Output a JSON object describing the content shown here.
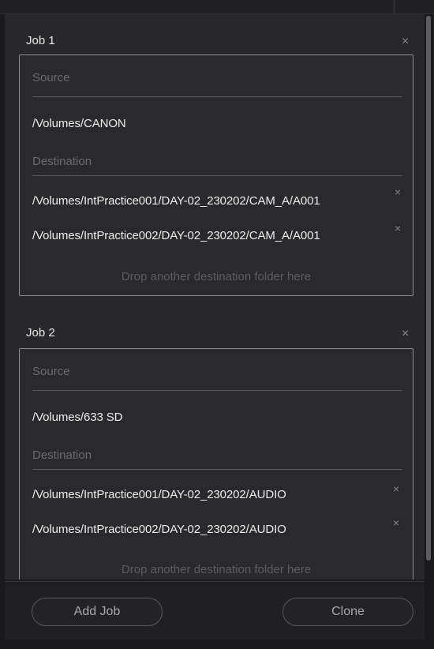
{
  "jobs": [
    {
      "title": "Job 1",
      "close_icon": "close-icon",
      "source_label": "Source",
      "source_path": "/Volumes/CANON",
      "destination_label": "Destination",
      "destinations": [
        "/Volumes/IntPractice001/DAY-02_230202/CAM_A/A001",
        "/Volumes/IntPractice002/DAY-02_230202/CAM_A/A001"
      ],
      "drop_hint": "Drop another destination folder here"
    },
    {
      "title": "Job 2",
      "close_icon": "close-icon",
      "source_label": "Source",
      "source_path": "/Volumes/633 SD",
      "destination_label": "Destination",
      "destinations": [
        "/Volumes/IntPractice001/DAY-02_230202/AUDIO",
        "/Volumes/IntPractice002/DAY-02_230202/AUDIO"
      ],
      "drop_hint": "Drop another destination folder here"
    }
  ],
  "footer": {
    "add_job_label": "Add Job",
    "clone_label": "Clone"
  },
  "icons": {
    "close": "×"
  },
  "colors": {
    "panel_bg": "#28282b",
    "box_border": "#8f8f93",
    "muted_text": "#6c6c70",
    "primary_text": "#ececec"
  }
}
